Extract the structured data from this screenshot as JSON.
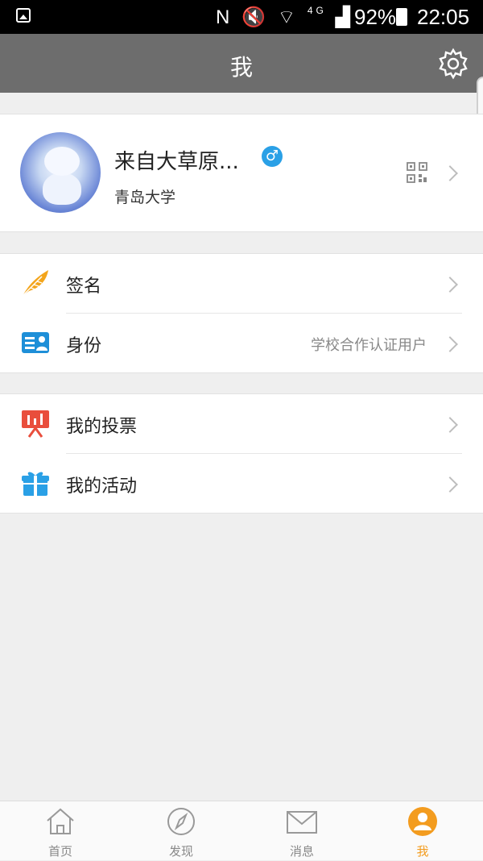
{
  "status_bar": {
    "battery": "92%",
    "time": "22:05",
    "network": "4G"
  },
  "header": {
    "title": "我"
  },
  "profile": {
    "name": "来自大草原...",
    "gender_symbol": "♂",
    "school": "青岛大学"
  },
  "menu_group_1": [
    {
      "label": "签名",
      "value": ""
    },
    {
      "label": "身份",
      "value": "学校合作认证用户"
    }
  ],
  "menu_group_2": [
    {
      "label": "我的投票"
    },
    {
      "label": "我的活动"
    }
  ],
  "tabs": [
    {
      "label": "首页",
      "icon": "home-icon"
    },
    {
      "label": "发现",
      "icon": "compass-icon"
    },
    {
      "label": "消息",
      "icon": "mail-icon"
    },
    {
      "label": "我",
      "icon": "user-icon",
      "active": true
    }
  ],
  "colors": {
    "header_bg": "#6d6d6d",
    "accent": "#f39c1f",
    "gender_blue": "#2aa0e6",
    "vote_red": "#e94e3c",
    "activity_blue": "#2aa0e6",
    "id_blue": "#1e8fd8"
  }
}
